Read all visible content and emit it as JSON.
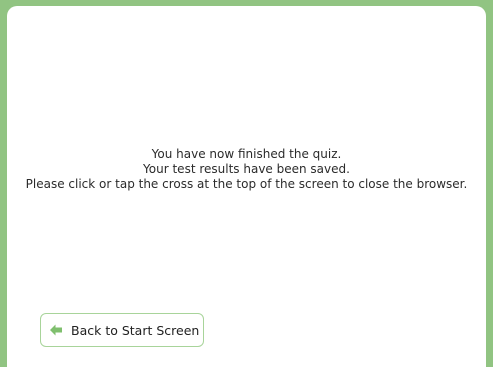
{
  "message": {
    "line1": "You have now finished the quiz.",
    "line2": "Your test results have been saved.",
    "line3": "Please click or tap the cross at the top of the screen to close the browser."
  },
  "back_button": {
    "label": "Back to Start Screen",
    "icon": "arrow-left-icon"
  },
  "colors": {
    "frame": "#91c482",
    "button_border": "#a8d49a",
    "icon": "#7fbf6e"
  }
}
